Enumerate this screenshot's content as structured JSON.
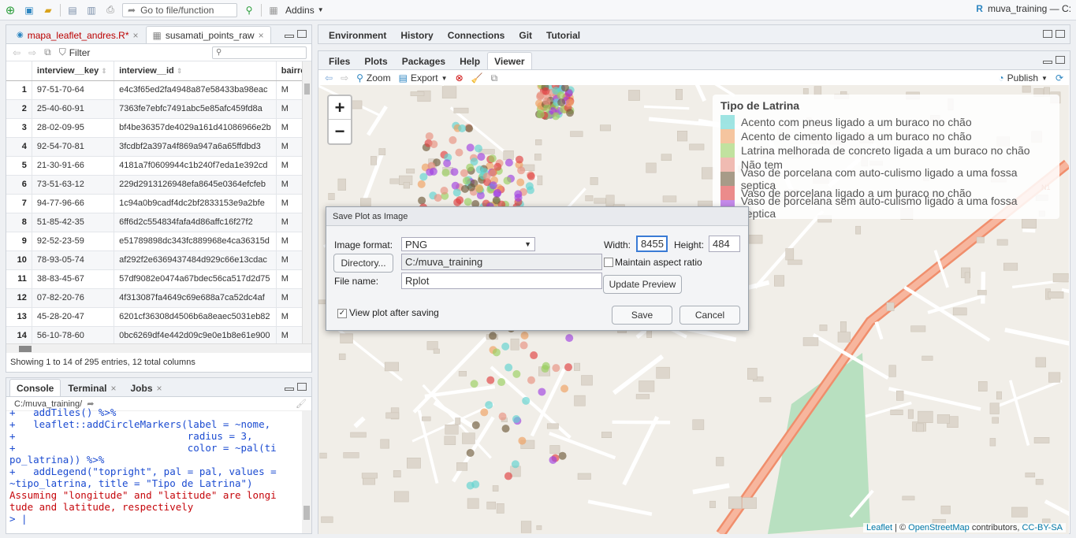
{
  "toolbar": {
    "goto_label": "Go to file/function",
    "addins_label": "Addins",
    "project_label": "muva_training — C:"
  },
  "source_tabs": [
    {
      "label": "mapa_leaflet_andres.R*"
    },
    {
      "label": "susamati_points_raw"
    }
  ],
  "dataviewer": {
    "filter_label": "Filter",
    "columns": [
      "",
      "interview__key",
      "interview__id",
      "bairro"
    ],
    "rows": [
      [
        "1",
        "97-51-70-64",
        "e4c3f65ed2fa4948a87e58433ba98eac",
        "M"
      ],
      [
        "2",
        "25-40-60-91",
        "7363fe7ebfc7491abc5e85afc459fd8a",
        "M"
      ],
      [
        "3",
        "28-02-09-95",
        "bf4be36357de4029a161d41086966e2b",
        "M"
      ],
      [
        "4",
        "92-54-70-81",
        "3fcdbf2a397a4f869a947a6a65ffdbd3",
        "M"
      ],
      [
        "5",
        "21-30-91-66",
        "4181a7f0609944c1b240f7eda1e392cd",
        "M"
      ],
      [
        "6",
        "73-51-63-12",
        "229d2913126948efa8645e0364efcfeb",
        "M"
      ],
      [
        "7",
        "94-77-96-66",
        "1c94a0b9cadf4dc2bf2833153e9a2bfe",
        "M"
      ],
      [
        "8",
        "51-85-42-35",
        "6ff6d2c554834fafa4d86affc16f27f2",
        "M"
      ],
      [
        "9",
        "92-52-23-59",
        "e51789898dc343fc889968e4ca36315d",
        "M"
      ],
      [
        "10",
        "78-93-05-74",
        "af292f2e6369437484d929c66e13cdac",
        "M"
      ],
      [
        "11",
        "38-83-45-67",
        "57df9082e0474a67bdec56ca517d2d75",
        "M"
      ],
      [
        "12",
        "07-82-20-76",
        "4f313087fa4649c69e688a7ca52dc4af",
        "M"
      ],
      [
        "13",
        "45-28-20-47",
        "6201cf36308d4506b6a8eaec5031eb82",
        "M"
      ],
      [
        "14",
        "56-10-78-60",
        "0bc6269df4e442d09c9e0e1b8e61e900",
        "M"
      ]
    ],
    "status": "Showing 1 to 14 of 295 entries, 12 total columns"
  },
  "console_tabs": [
    "Console",
    "Terminal",
    "Jobs"
  ],
  "console": {
    "path": "C:/muva_training/",
    "lines": [
      {
        "text": "+   addTiles() %>%",
        "cls": "cblue"
      },
      {
        "text": "+   leaflet::addCircleMarkers(label = ~nome,",
        "cls": "cblue"
      },
      {
        "text": "+                             radius = 3,",
        "cls": "cblue"
      },
      {
        "text": "+                             color = ~pal(ti",
        "cls": "cblue"
      },
      {
        "text": "po_latrina)) %>%",
        "cls": "cblue"
      },
      {
        "text": "+   addLegend(\"topright\", pal = pal, values =",
        "cls": "cblue"
      },
      {
        "text": "~tipo_latrina, title = \"Tipo de Latrina\")",
        "cls": "cblue"
      },
      {
        "text": "Assuming \"longitude\" and \"latitude\" are longi",
        "cls": "cred"
      },
      {
        "text": "tude and latitude, respectively",
        "cls": "cred"
      },
      {
        "text": "> |",
        "cls": "cblue"
      }
    ]
  },
  "env_tabs": [
    "Environment",
    "History",
    "Connections",
    "Git",
    "Tutorial"
  ],
  "viewer_tabs": [
    "Files",
    "Plots",
    "Packages",
    "Help",
    "Viewer"
  ],
  "viewer_toolbar": {
    "zoom_label": "Zoom",
    "export_label": "Export",
    "publish_label": "Publish"
  },
  "map": {
    "zoom_in": "+",
    "zoom_out": "−",
    "legend_title": "Tipo de Latrina",
    "legend_items": [
      {
        "label": "Acento com pneus ligado a um buraco no chão",
        "color": "#5fd3d0"
      },
      {
        "label": "Acento de cimento ligado a um buraco no chão",
        "color": "#f0a060"
      },
      {
        "label": "Latrina melhorada de concreto ligada a um buraco no chão",
        "color": "#9ad060"
      },
      {
        "label": "Não tem",
        "color": "#e89080"
      },
      {
        "label": "Vaso de porcelana com auto-culismo ligado a uma fossa septica",
        "color": "#6e5a3a"
      },
      {
        "label": "Vaso de porcelana ligado a um buraco no chão",
        "color": "#e04040"
      },
      {
        "label": "Vaso de porcelana sem auto-culismo ligado a uma fossa septica",
        "color": "#a040e0"
      }
    ],
    "attribution_leaflet": "Leaflet",
    "attribution_osm": "OpenStreetMap",
    "attribution_rest": " contributors, ",
    "attribution_license": "CC-BY-SA",
    "map_label": "N1"
  },
  "dialog": {
    "title": "Save Plot as Image",
    "format_label": "Image format:",
    "format_value": "PNG",
    "width_label": "Width:",
    "width_value": "8455",
    "height_label": "Height:",
    "height_value": "484",
    "directory_button": "Directory...",
    "directory_value": "C:/muva_training",
    "aspect_label": "Maintain aspect ratio",
    "filename_label": "File name:",
    "filename_value": "Rplot",
    "update_button": "Update Preview",
    "view_after_label": "View plot after saving",
    "save_button": "Save",
    "cancel_button": "Cancel"
  }
}
